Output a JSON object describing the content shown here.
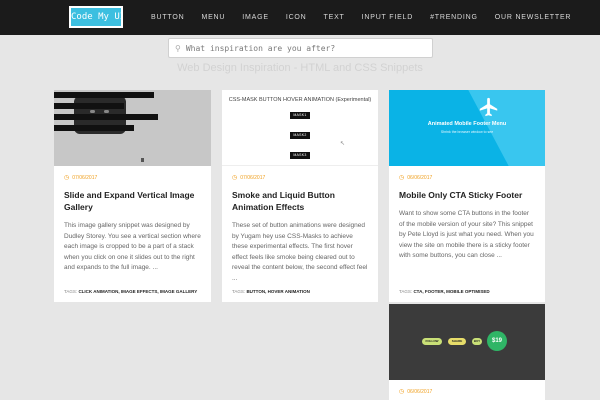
{
  "logo": "Code My UI",
  "nav": [
    "BUTTON",
    "MENU",
    "IMAGE",
    "ICON",
    "TEXT",
    "INPUT FIELD",
    "#TRENDING",
    "OUR NEWSLETTER"
  ],
  "search": {
    "placeholder": "What inspiration are you after?",
    "icon": "search-icon"
  },
  "hero_title": "Web Design Inspiration - HTML and CSS Snippets",
  "cards": [
    {
      "date": "07/06/2017",
      "title": "Slide and Expand Vertical Image Gallery",
      "excerpt": "This image gallery snippet was designed by Dudley Storey. You see a vertical section where each image is cropped to be a part of a stack when you click on one it slides out to the right and expands to the full image. ...",
      "tags_label": "TAGS:",
      "tags": "CLICK ANIMATION, IMAGE EFFECTS, IMAGE GALLERY"
    },
    {
      "date": "07/06/2017",
      "title": "Smoke and Liquid Button Animation Effects",
      "excerpt": "These set of button animations were designed by Yugam hey use CSS-Masks to achieve these experimental effects. The first hover effect feels like smoke being cleared out to reveal the content below, the second effect feel ...",
      "tags_label": "TAGS:",
      "tags": "BUTTON, HOVER ANIMATION",
      "thumb_caption": "CSS-MASK BUTTON HOVER ANIMATION (Experimental)",
      "thumb_buttons": [
        "MASK1",
        "MASK2",
        "MASK3"
      ]
    },
    {
      "date": "06/06/2017",
      "title": "Mobile Only CTA Sticky Footer",
      "excerpt": "Want to show some CTA buttons in the footer of the mobile version of your site? This snippet by Pete Lloyd is just what you need. When you view the site on mobile there is a sticky footer with some buttons, you can close ...",
      "tags_label": "TAGS:",
      "tags": "CTA, FOOTER, MOBILE OPTIMISED",
      "thumb_title": "Animated Mobile Footer Menu",
      "thumb_sub": "Shrink the browser window to see"
    },
    {
      "date": "06/06/2017",
      "thumb_pills": [
        "FOLLOW",
        "SHARE",
        "BUY"
      ],
      "thumb_price": "$19"
    }
  ],
  "colors": {
    "accent": "#f0a020",
    "nav_bg": "#1b1b1b",
    "logo_bg": "#3cbfe0"
  }
}
